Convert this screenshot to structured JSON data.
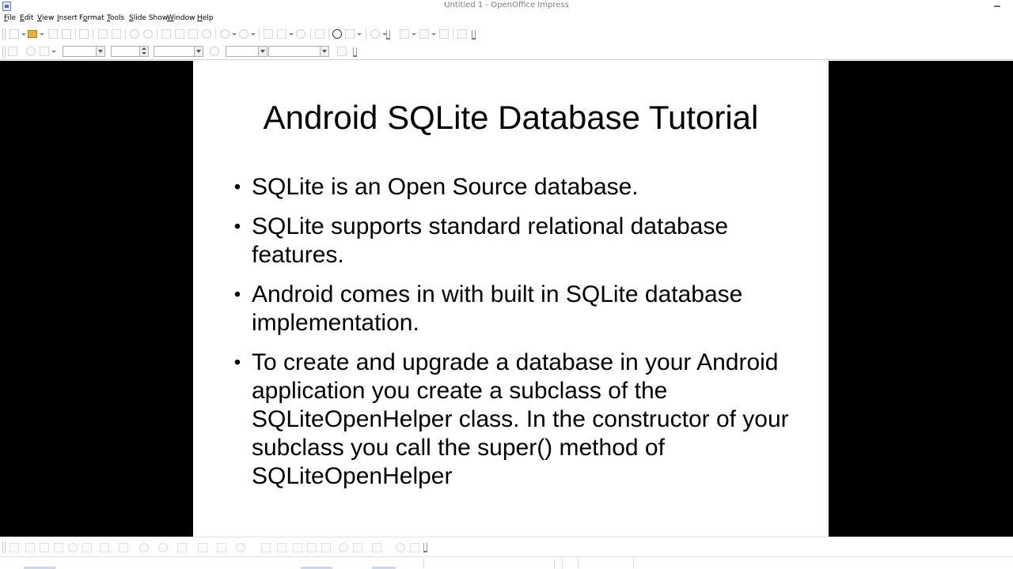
{
  "window": {
    "title": "Untitled 1 - OpenOffice Impress",
    "app_icon": "impress-app-icon",
    "minimize_icon": "minimize-icon"
  },
  "menu": {
    "items": [
      {
        "label": "File",
        "mnemonic": "F",
        "rest": "ile"
      },
      {
        "label": "Edit",
        "mnemonic": "E",
        "rest": "dit"
      },
      {
        "label": "View",
        "mnemonic": "V",
        "rest": "iew"
      },
      {
        "label": "Insert",
        "mnemonic": "I",
        "rest": "nsert"
      },
      {
        "label": "Format",
        "pre": "F",
        "mnemonic": "o",
        "rest": "rmat"
      },
      {
        "label": "Tools",
        "mnemonic": "T",
        "rest": "ools"
      },
      {
        "label": "Slide Show",
        "mnemonic": "S",
        "rest": "lide Show"
      },
      {
        "label": "Window",
        "mnemonic": "W",
        "rest": "indow"
      },
      {
        "label": "Help",
        "mnemonic": "H",
        "rest": "elp"
      }
    ]
  },
  "toolbar_standard": {
    "icons": [
      "new-document-icon",
      "open-folder-icon",
      "save-icon",
      "edit-file-icon",
      "export-pdf-icon",
      "print-icon",
      "spellcheck-icon",
      "cut-icon",
      "copy-icon",
      "paste-icon",
      "clone-format-icon",
      "undo-icon",
      "redo-icon",
      "chart-icon",
      "table-icon",
      "hyperlink-icon",
      "grid-icon",
      "display-quality-icon",
      "help-icon"
    ]
  },
  "toolbar_formatting": {
    "font_name": "",
    "font_size": "",
    "line_style": "",
    "line_width": "",
    "area_style": ""
  },
  "slide": {
    "title": "Android SQLite Database Tutorial",
    "bullets": [
      "SQLite is an Open Source database.",
      "SQLite supports standard relational database features.",
      "Android comes in with built in SQLite database implementation.",
      "To create and upgrade a database in your Android application you create a subclass of the SQLiteOpenHelper class. In the constructor of your subclass you call the super() method of SQLiteOpenHelper"
    ],
    "bullet_symbol": "•"
  },
  "colors": {
    "workspace_bg": "#000000",
    "slide_bg": "#ffffff",
    "text": "#000000"
  }
}
